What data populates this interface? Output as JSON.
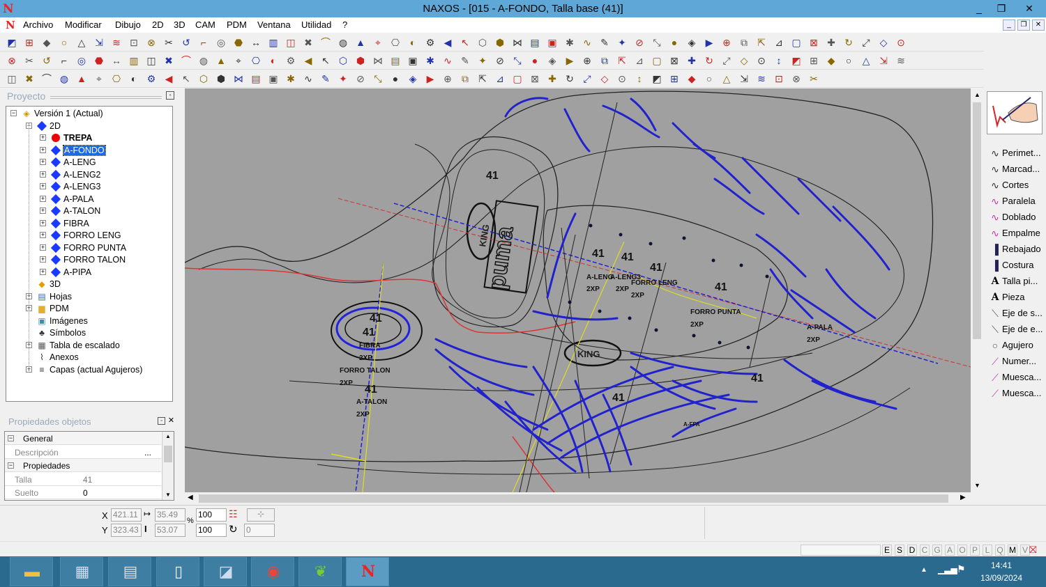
{
  "titlebar": {
    "title": "NAXOS - [015 - A-FONDO, Talla base (41)]",
    "min": "_",
    "max": "❐",
    "close": "✕"
  },
  "menu": [
    "Archivo",
    "Modificar",
    "Dibujo",
    "2D",
    "3D",
    "CAM",
    "PDM",
    "Ventana",
    "Utilidad",
    "?"
  ],
  "project": {
    "header": "Proyecto",
    "tree": [
      {
        "label": "Versión 1 (Actual)",
        "level": 0,
        "exp": "−",
        "icon": "version"
      },
      {
        "label": "2D",
        "level": 1,
        "exp": "−",
        "icon": "diamond"
      },
      {
        "label": "TREPA",
        "level": 2,
        "exp": "+",
        "icon": "red",
        "bold": true
      },
      {
        "label": "A-FONDO",
        "level": 2,
        "exp": "+",
        "icon": "diamond",
        "selected": true
      },
      {
        "label": "A-LENG",
        "level": 2,
        "exp": "+",
        "icon": "diamond"
      },
      {
        "label": "A-LENG2",
        "level": 2,
        "exp": "+",
        "icon": "diamond"
      },
      {
        "label": "A-LENG3",
        "level": 2,
        "exp": "+",
        "icon": "diamond"
      },
      {
        "label": "A-PALA",
        "level": 2,
        "exp": "+",
        "icon": "diamond"
      },
      {
        "label": "A-TALON",
        "level": 2,
        "exp": "+",
        "icon": "diamond"
      },
      {
        "label": "FIBRA",
        "level": 2,
        "exp": "+",
        "icon": "diamond"
      },
      {
        "label": "FORRO LENG",
        "level": 2,
        "exp": "+",
        "icon": "diamond"
      },
      {
        "label": "FORRO PUNTA",
        "level": 2,
        "exp": "+",
        "icon": "diamond"
      },
      {
        "label": "FORRO TALON",
        "level": 2,
        "exp": "+",
        "icon": "diamond"
      },
      {
        "label": "A-PIPA",
        "level": 2,
        "exp": "+",
        "icon": "diamond"
      },
      {
        "label": "3D",
        "level": 1,
        "exp": "",
        "icon": "3d"
      },
      {
        "label": "Hojas",
        "level": 1,
        "exp": "+",
        "icon": "sheets"
      },
      {
        "label": "PDM",
        "level": 1,
        "exp": "+",
        "icon": "folder"
      },
      {
        "label": "Imágenes",
        "level": 1,
        "exp": "",
        "icon": "image"
      },
      {
        "label": "Símbolos",
        "level": 1,
        "exp": "",
        "icon": "symbol"
      },
      {
        "label": "Tabla de escalado",
        "level": 1,
        "exp": "+",
        "icon": "table"
      },
      {
        "label": "Anexos",
        "level": 1,
        "exp": "",
        "icon": "clip"
      },
      {
        "label": "Capas (actual Agujeros)",
        "level": 1,
        "exp": "+",
        "icon": "layers"
      }
    ]
  },
  "properties": {
    "header": "Propiedades objetos",
    "rows": [
      {
        "key": "General",
        "value": "",
        "section": true
      },
      {
        "key": "Descripción",
        "value": "...",
        "section": false
      },
      {
        "key": "Propiedades",
        "value": "",
        "section": true
      },
      {
        "key": "Talla",
        "value": "41",
        "section": false
      },
      {
        "key": "Suelto",
        "value": "0",
        "section": false
      }
    ]
  },
  "right_panel": [
    "Perimet...",
    "Marcad...",
    "Cortes",
    "Paralela",
    "Doblado",
    "Empalme",
    "Rebajado",
    "Costura",
    "Talla pi...",
    "Pieza",
    "Eje de s...",
    "Eje de e...",
    "Agujero",
    "Numer...",
    "Muesca...",
    "Muesca..."
  ],
  "status": {
    "x_label": "X",
    "y_label": "Y",
    "x": "421.11",
    "y": "323.43",
    "w": "35.49",
    "h": "53.07",
    "sx": "100",
    "sy": "100",
    "pct": "%",
    "angle": "0"
  },
  "layer_letters": [
    "E",
    "S",
    "D",
    "C",
    "G",
    "A",
    "O",
    "P",
    "L",
    "Q",
    "M",
    "V"
  ],
  "layer_active": [
    "E",
    "S",
    "D",
    "M"
  ],
  "canvas_labels": [
    "41",
    "FIBRA",
    "2XP",
    "FORRO TALON",
    "A-TALON",
    "A-LENG",
    "A-LENG3",
    "FORRO LENG",
    "FORRO PUNTA",
    "A-PALA",
    "A-FFA",
    "KING",
    "puma"
  ],
  "clock": {
    "time": "14:41",
    "date": "13/09/2024"
  }
}
